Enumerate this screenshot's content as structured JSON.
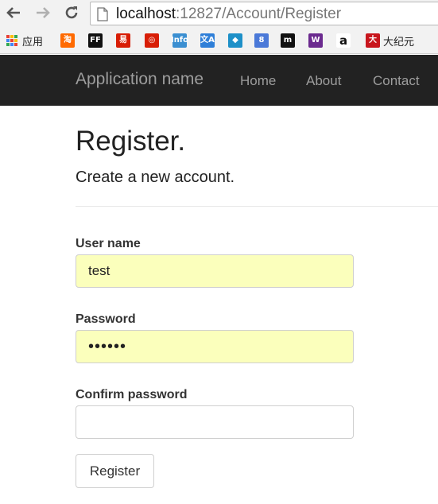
{
  "browser": {
    "url_host": "localhost",
    "url_rest": ":12827/Account/Register",
    "bookmarks": [
      {
        "name": "apps",
        "label": "应用",
        "glyph": "",
        "color": "#4a8ad4"
      },
      {
        "name": "taobao",
        "label": "",
        "glyph": "淘",
        "color": "#ff6a00"
      },
      {
        "name": "ff",
        "label": "",
        "glyph": "FF",
        "color": "#111111"
      },
      {
        "name": "yi",
        "label": "",
        "glyph": "易",
        "color": "#d81e06"
      },
      {
        "name": "swirl",
        "label": "",
        "glyph": "◎",
        "color": "#d81e06"
      },
      {
        "name": "info",
        "label": "",
        "glyph": "Info",
        "color": "#3b8fd1"
      },
      {
        "name": "translate",
        "label": "",
        "glyph": "文A",
        "color": "#2f7fd8"
      },
      {
        "name": "azure",
        "label": "",
        "glyph": "◆",
        "color": "#1e90c8"
      },
      {
        "name": "google-8",
        "label": "",
        "glyph": "8",
        "color": "#4b79d8"
      },
      {
        "name": "m",
        "label": "",
        "glyph": "m",
        "color": "#111111"
      },
      {
        "name": "w",
        "label": "",
        "glyph": "W",
        "color": "#6b2a8f"
      },
      {
        "name": "amazon",
        "label": "",
        "glyph": "a",
        "color": "#ffffff"
      },
      {
        "name": "epoch",
        "label": "大纪元",
        "glyph": "大",
        "color": "#c8161d"
      }
    ]
  },
  "navbar": {
    "brand": "Application name",
    "links": [
      "Home",
      "About",
      "Contact"
    ]
  },
  "page": {
    "title": "Register.",
    "subtitle": "Create a new account."
  },
  "form": {
    "username_label": "User name",
    "username_value": "test",
    "password_label": "Password",
    "password_value": "••••••",
    "confirm_label": "Confirm password",
    "confirm_value": "",
    "submit_label": "Register"
  }
}
